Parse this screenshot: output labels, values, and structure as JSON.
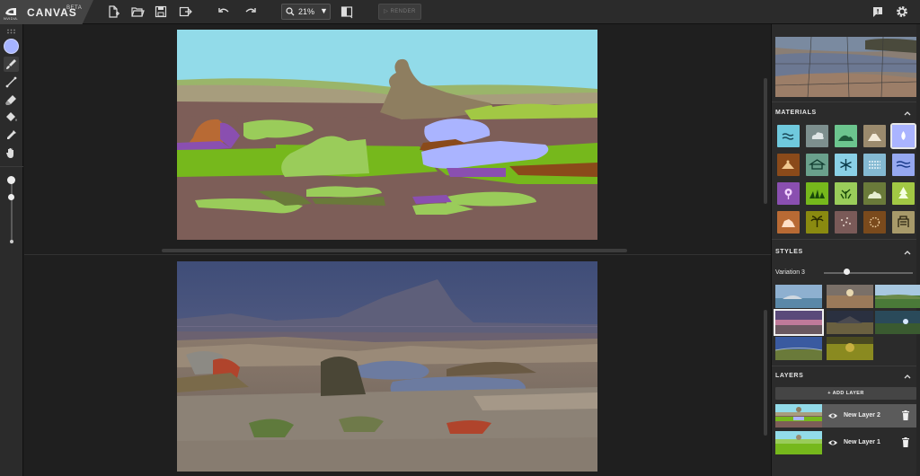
{
  "header": {
    "vendor_text": "NVIDIA.",
    "app_name": "CANVAS",
    "beta_label": "BETA",
    "zoom_value": "21%",
    "render_label": "RENDER",
    "toolbar_icons": [
      "new-file-icon",
      "open-folder-icon",
      "save-icon",
      "export-icon",
      "undo-icon",
      "redo-icon",
      "compare-icon",
      "feedback-icon",
      "gear-icon"
    ]
  },
  "left_tools": {
    "active_color": "#a6b4ff",
    "tools": [
      "palette-icon",
      "brush-icon",
      "line-icon",
      "eraser-icon",
      "fill-icon",
      "eyedropper-icon",
      "hand-icon"
    ]
  },
  "panel": {
    "materials_title": "MATERIALS",
    "styles_title": "STYLES",
    "variation_label": "Variation 3",
    "variation_value": 0.25,
    "layers_title": "LAYERS",
    "add_layer_label": "+ ADD LAYER",
    "materials": [
      {
        "name": "sea",
        "color": "#6fc9dd",
        "icon": "sea-icon"
      },
      {
        "name": "cloud",
        "color": "#7d8f8e",
        "icon": "cloud-icon"
      },
      {
        "name": "hill",
        "color": "#6cc58e",
        "icon": "hill-icon"
      },
      {
        "name": "mountain",
        "color": "#9b8a6d",
        "icon": "mountain-icon"
      },
      {
        "name": "water",
        "color": "#aab4ff",
        "icon": "water-icon",
        "selected": true
      },
      {
        "name": "dirt",
        "color": "#8a4a1a",
        "icon": "dirt-icon"
      },
      {
        "name": "building",
        "color": "#6aa08c",
        "icon": "building-icon"
      },
      {
        "name": "snow",
        "color": "#8ad0e6",
        "icon": "snow-icon"
      },
      {
        "name": "fog",
        "color": "#84b9d2",
        "icon": "fog-icon"
      },
      {
        "name": "river",
        "color": "#96a8f0",
        "icon": "river-icon"
      },
      {
        "name": "flower",
        "color": "#8a4fb0",
        "icon": "flower-icon"
      },
      {
        "name": "grass",
        "color": "#76b81c",
        "icon": "grass-icon"
      },
      {
        "name": "plant",
        "color": "#9acc5a",
        "icon": "plant-icon"
      },
      {
        "name": "bush",
        "color": "#6a7a3a",
        "icon": "bush-icon"
      },
      {
        "name": "tree",
        "color": "#a2c844",
        "icon": "tree-icon"
      },
      {
        "name": "rock",
        "color": "#b86a34",
        "icon": "rock-icon"
      },
      {
        "name": "palm",
        "color": "#8a8a10",
        "icon": "palm-icon"
      },
      {
        "name": "gravel",
        "color": "#7a5a58",
        "icon": "gravel-icon"
      },
      {
        "name": "sand",
        "color": "#7a4a1c",
        "icon": "sand-icon"
      },
      {
        "name": "stone",
        "color": "#a89a6a",
        "icon": "stone-icon"
      }
    ],
    "layers": [
      {
        "name": "New Layer 2",
        "active": true
      },
      {
        "name": "New Layer 1",
        "active": false
      }
    ]
  }
}
